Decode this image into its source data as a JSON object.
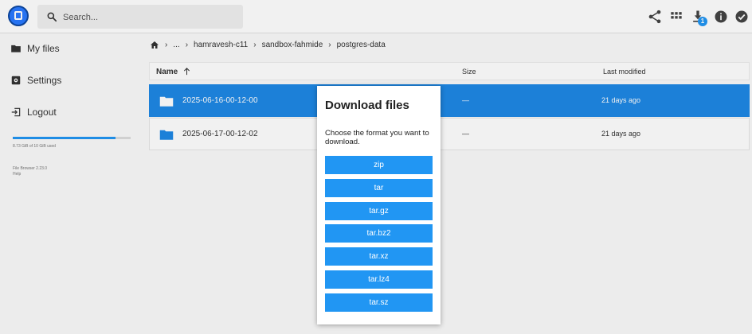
{
  "header": {
    "search_placeholder": "Search...",
    "download_badge": "1",
    "icons": [
      "logo-icon",
      "search-icon",
      "share-icon",
      "grid-view-icon",
      "download-icon",
      "info-icon",
      "check-circle-icon"
    ]
  },
  "sidebar": {
    "items": [
      {
        "label": "My files",
        "icon": "folder-icon"
      },
      {
        "label": "Settings",
        "icon": "settings-icon"
      },
      {
        "label": "Logout",
        "icon": "logout-icon"
      }
    ],
    "storage_text": "8.73 GiB of 10 GiB used",
    "storage_fraction": 0.873,
    "credits_line1": "File Browser 2.23.0",
    "credits_line2": "Help"
  },
  "breadcrumbs": [
    "...",
    "hamravesh-c11",
    "sandbox-fahmide",
    "postgres-data"
  ],
  "table": {
    "headers": {
      "name": "Name",
      "size": "Size",
      "modified": "Last modified"
    },
    "rows": [
      {
        "name": "2025-06-16-00-12-00",
        "size": "—",
        "modified": "21 days ago",
        "selected": true
      },
      {
        "name": "2025-06-17-00-12-02",
        "size": "—",
        "modified": "21 days ago",
        "selected": false
      }
    ]
  },
  "dialog": {
    "title": "Download files",
    "text": "Choose the format you want to download.",
    "formats": [
      "zip",
      "tar",
      "tar.gz",
      "tar.bz2",
      "tar.xz",
      "tar.lz4",
      "tar.sz"
    ]
  },
  "colors": {
    "accent": "#2196f3",
    "selected_row": "#1e88e5"
  }
}
